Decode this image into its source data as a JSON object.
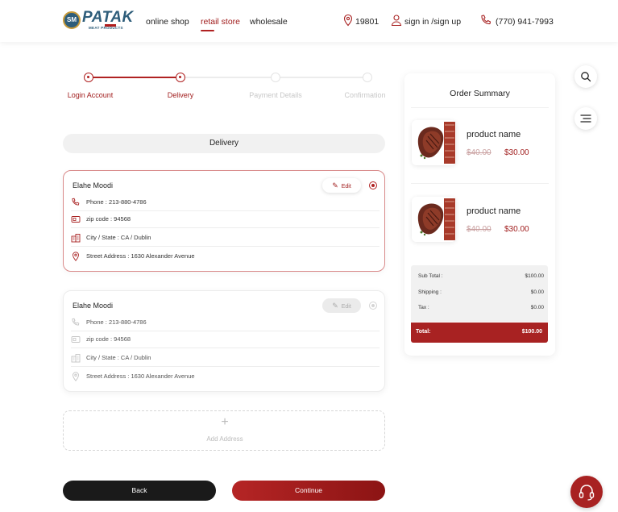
{
  "brand": {
    "name": "PATAK",
    "tagline": "MEAT PRODUCTS",
    "badge": "SM",
    "primary_color": "#a82222",
    "brand_blue": "#2e5d7a"
  },
  "nav": {
    "items": [
      {
        "label": "online shop",
        "active": false
      },
      {
        "label": "retail store",
        "active": true
      },
      {
        "label": "wholesale",
        "active": false
      }
    ]
  },
  "header": {
    "location_icon": "map-pin-icon",
    "zip": "19801",
    "user_icon": "user-icon",
    "account_link": "sign in /sign up",
    "phone_icon": "phone-icon",
    "phone": "(770) 941-7993"
  },
  "stepper": {
    "steps": [
      {
        "label": "Login Account",
        "state": "done"
      },
      {
        "label": "Delivery",
        "state": "done"
      },
      {
        "label": "Payment Details",
        "state": "todo"
      },
      {
        "label": "Confirmation",
        "state": "todo"
      }
    ]
  },
  "section_title": "Delivery",
  "addresses": [
    {
      "name": "Elahe Moodi",
      "edit_label": "Edit",
      "selected": true,
      "phone": "Phone : 213-880-4786",
      "zip": "zip code : 94568",
      "city": "City / State : CA / Dublin",
      "street": "Street Address : 1630 Alexander Avenue"
    },
    {
      "name": "Elahe Moodi",
      "edit_label": "Edit",
      "selected": false,
      "phone": "Phone : 213-880-4786",
      "zip": "zip code : 94568",
      "city": "City / State : CA / Dublin",
      "street": "Street Address : 1630 Alexander Avenue"
    }
  ],
  "add_address": {
    "icon": "plus-icon",
    "label": "Add Address"
  },
  "actions": {
    "back_label": "Back",
    "continue_label": "Continue"
  },
  "summary": {
    "title": "Order Summary",
    "products": [
      {
        "name": "product name",
        "old_price": "$40.00",
        "price": "$30.00"
      },
      {
        "name": "product name",
        "old_price": "$40.00",
        "price": "$30.00"
      }
    ],
    "subtotal_label": "Sub Total :",
    "subtotal": "$100.00",
    "shipping_label": "Shipping :",
    "shipping": "$0.00",
    "tax_label": "Tax :",
    "tax": "$0.00",
    "total_label": "Total:",
    "total": "$100.00"
  },
  "floating": {
    "search_icon": "search-icon",
    "menu_icon": "menu-icon",
    "support_icon": "headset-icon"
  }
}
